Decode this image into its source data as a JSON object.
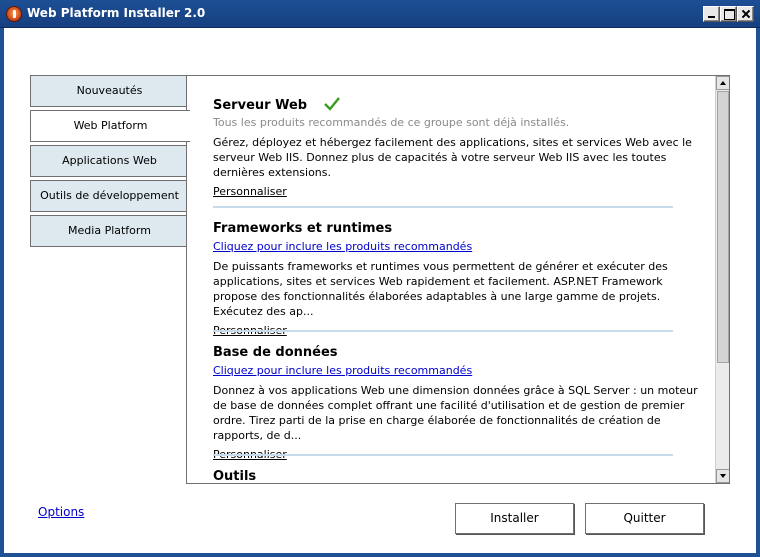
{
  "window": {
    "title": "Web Platform Installer 2.0"
  },
  "nav": {
    "tabs": [
      {
        "label": "Nouveautés",
        "active": false
      },
      {
        "label": "Web Platform",
        "active": true
      },
      {
        "label": "Applications Web",
        "active": false
      },
      {
        "label": "Outils de développement",
        "active": false
      },
      {
        "label": "Media Platform",
        "active": false
      }
    ]
  },
  "sections": [
    {
      "title": "Serveur Web",
      "status": "Tous les produits recommandés de ce groupe sont déjà installés.",
      "status_icon": "checkmark-icon",
      "description": "Gérez, déployez et hébergez facilement des applications, sites et services Web avec le serveur Web IIS. Donnez plus de capacités à votre serveur Web IIS avec les toutes dernières extensions.",
      "customize_label": "Personnaliser"
    },
    {
      "title": "Frameworks et runtimes",
      "recommend_link": "Cliquez pour inclure les produits recommandés",
      "description": "De puissants frameworks et runtimes vous permettent de générer et exécuter des applications, sites et services Web rapidement et facilement.  ASP.NET Framework propose des fonctionnalités élaborées adaptables à une large gamme de projets. Exécutez des ap...",
      "customize_label": "Personnaliser"
    },
    {
      "title": "Base de données",
      "recommend_link": "Cliquez pour inclure les produits recommandés",
      "description": "Donnez à vos applications Web une dimension données grâce à SQL Server : un moteur de base de données complet offrant une facilité d'utilisation et de gestion de premier ordre. Tirez parti de la prise en charge élaborée de fonctionnalités de création de rapports, de d...",
      "customize_label": "Personnaliser"
    },
    {
      "title": "Outils"
    }
  ],
  "footer": {
    "options_label": "Options",
    "install_label": "Installer",
    "quit_label": "Quitter"
  },
  "colors": {
    "titlebar": "#1d4f94",
    "tab_inactive": "#dde9ef",
    "link": "#0000cc",
    "check_green": "#3a9a1e",
    "separator": "#c7dbea"
  }
}
